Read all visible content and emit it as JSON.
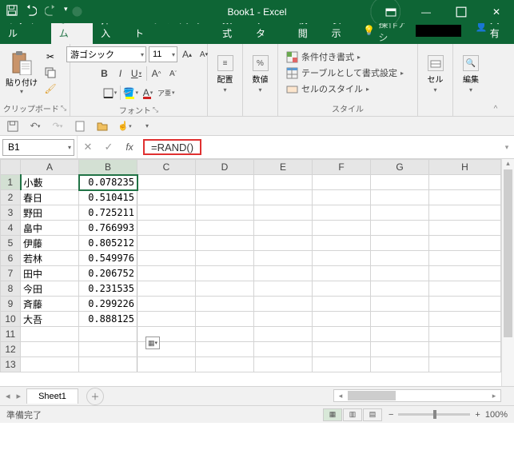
{
  "title": "Book1 - Excel",
  "tabs": [
    "ファイル",
    "ホーム",
    "挿入",
    "ページ レイアウト",
    "数式",
    "データ",
    "校閲",
    "表示"
  ],
  "active_tab": "ホーム",
  "tellme": "操作アシ",
  "share": "共有",
  "ribbon": {
    "clipboard": {
      "paste": "貼り付け",
      "label": "クリップボード"
    },
    "font": {
      "name": "游ゴシック",
      "size": "11",
      "label": "フォント"
    },
    "align": {
      "label": "配置"
    },
    "number": {
      "symbol": "%",
      "label": "数値"
    },
    "styles": {
      "cond": "条件付き書式",
      "table": "テーブルとして書式設定",
      "cell": "セルのスタイル",
      "label": "スタイル"
    },
    "cells": {
      "label": "セル"
    },
    "editing": {
      "label": "編集"
    }
  },
  "namebox": "B1",
  "formula": "=RAND()",
  "columns": [
    "A",
    "B",
    "C",
    "D",
    "E",
    "F",
    "G",
    "H"
  ],
  "rows": [
    {
      "n": 1,
      "a": "小藪",
      "b": "0.078235"
    },
    {
      "n": 2,
      "a": "春日",
      "b": "0.510415"
    },
    {
      "n": 3,
      "a": "野田",
      "b": "0.725211"
    },
    {
      "n": 4,
      "a": "畠中",
      "b": "0.766993"
    },
    {
      "n": 5,
      "a": "伊藤",
      "b": "0.805212"
    },
    {
      "n": 6,
      "a": "若林",
      "b": "0.549976"
    },
    {
      "n": 7,
      "a": "田中",
      "b": "0.206752"
    },
    {
      "n": 8,
      "a": "今田",
      "b": "0.231535"
    },
    {
      "n": 9,
      "a": "斉藤",
      "b": "0.299226"
    },
    {
      "n": 10,
      "a": "大吾",
      "b": "0.888125"
    },
    {
      "n": 11,
      "a": "",
      "b": ""
    },
    {
      "n": 12,
      "a": "",
      "b": ""
    },
    {
      "n": 13,
      "a": "",
      "b": ""
    }
  ],
  "selected_cell": "B1",
  "sheet": "Sheet1",
  "status": "準備完了",
  "zoom": "100%"
}
